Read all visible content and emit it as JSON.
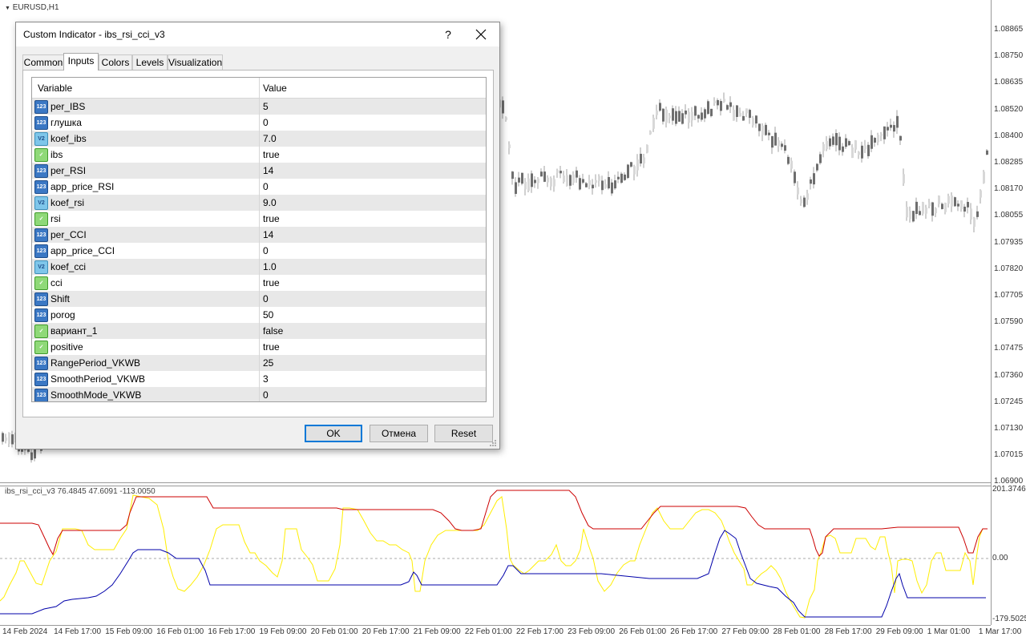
{
  "chart": {
    "symbol": "EURUSD,H1",
    "price_labels": [
      "1.08865",
      "1.08750",
      "1.08635",
      "1.08520",
      "1.08400",
      "1.08285",
      "1.08170",
      "1.08055",
      "1.07935",
      "1.07820",
      "1.07705",
      "1.07590",
      "1.07475",
      "1.07360",
      "1.07245",
      "1.07130",
      "1.07015",
      "1.06900"
    ],
    "date_labels": [
      "14 Feb 2024",
      "14 Feb 17:00",
      "15 Feb 09:00",
      "16 Feb 01:00",
      "16 Feb 17:00",
      "19 Feb 09:00",
      "20 Feb 01:00",
      "20 Feb 17:00",
      "21 Feb 09:00",
      "22 Feb 01:00",
      "22 Feb 17:00",
      "23 Feb 09:00",
      "26 Feb 01:00",
      "26 Feb 17:00",
      "27 Feb 09:00",
      "28 Feb 01:00",
      "28 Feb 17:00",
      "29 Feb 09:00",
      "1 Mar 01:00",
      "1 Mar 17:00"
    ],
    "subwindow": {
      "title": "ibs_rsi_cci_v3 76.4845 47.6091 -113.0050",
      "max_label": "201.3746",
      "zero_label": "0.00",
      "min_label": "-179.5025",
      "colors": {
        "red": "#cc0000",
        "yellow": "#ffee00",
        "blue": "#0000aa"
      }
    }
  },
  "dialog": {
    "title": "Custom Indicator - ibs_rsi_cci_v3",
    "help_label": "?",
    "tabs": [
      "Common",
      "Inputs",
      "Colors",
      "Levels",
      "Visualization"
    ],
    "active_tab": "Inputs",
    "columns": {
      "variable": "Variable",
      "value": "Value"
    },
    "params": [
      {
        "type": "int",
        "icon": "123",
        "name": "per_IBS",
        "value": "5"
      },
      {
        "type": "int",
        "icon": "123",
        "name": "глушка",
        "value": "0"
      },
      {
        "type": "double",
        "icon": "V2",
        "name": "koef_ibs",
        "value": "7.0"
      },
      {
        "type": "bool",
        "icon": "✓",
        "name": "ibs",
        "value": "true"
      },
      {
        "type": "int",
        "icon": "123",
        "name": "per_RSI",
        "value": "14"
      },
      {
        "type": "int",
        "icon": "123",
        "name": "app_price_RSI",
        "value": "0"
      },
      {
        "type": "double",
        "icon": "V2",
        "name": "koef_rsi",
        "value": "9.0"
      },
      {
        "type": "bool",
        "icon": "✓",
        "name": "rsi",
        "value": "true"
      },
      {
        "type": "int",
        "icon": "123",
        "name": "per_CCI",
        "value": "14"
      },
      {
        "type": "int",
        "icon": "123",
        "name": "app_price_CCI",
        "value": "0"
      },
      {
        "type": "double",
        "icon": "V2",
        "name": "koef_cci",
        "value": "1.0"
      },
      {
        "type": "bool",
        "icon": "✓",
        "name": "cci",
        "value": "true"
      },
      {
        "type": "int",
        "icon": "123",
        "name": "Shift",
        "value": "0"
      },
      {
        "type": "int",
        "icon": "123",
        "name": "porog",
        "value": "50"
      },
      {
        "type": "bool",
        "icon": "✓",
        "name": "вариант_1",
        "value": "false"
      },
      {
        "type": "bool",
        "icon": "✓",
        "name": "positive",
        "value": "true"
      },
      {
        "type": "int",
        "icon": "123",
        "name": "RangePeriod_VKWB",
        "value": "25"
      },
      {
        "type": "int",
        "icon": "123",
        "name": "SmoothPeriod_VKWB",
        "value": "3"
      },
      {
        "type": "int",
        "icon": "123",
        "name": "SmoothMode_VKWB",
        "value": "0"
      }
    ],
    "buttons": {
      "ok": "OK",
      "cancel": "Отмена",
      "reset": "Reset"
    }
  }
}
